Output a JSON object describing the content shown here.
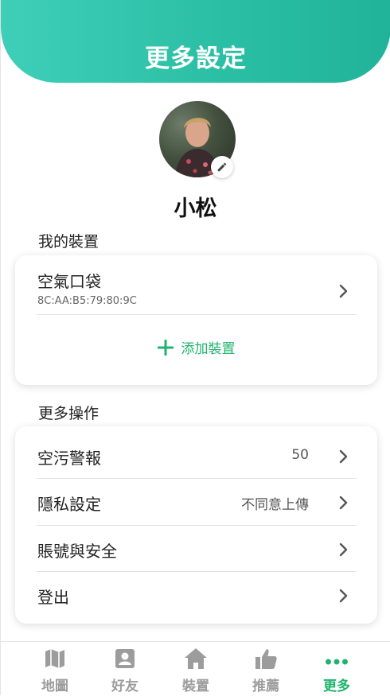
{
  "header": {
    "title": "更多設定"
  },
  "profile": {
    "name": "小松"
  },
  "devices": {
    "section_title": "我的裝置",
    "items": [
      {
        "name": "空氣口袋",
        "mac": "8C:AA:B5:79:80:9C"
      }
    ],
    "add_label": "添加裝置"
  },
  "operations": {
    "section_title": "更多操作",
    "items": [
      {
        "label": "空污警報",
        "value": "50"
      },
      {
        "label": "隱私設定",
        "value": "不同意上傳"
      },
      {
        "label": "賬號與安全",
        "value": ""
      },
      {
        "label": "登出",
        "value": ""
      }
    ]
  },
  "tabbar": {
    "active": "更多",
    "tabs": [
      {
        "label": "地圖",
        "icon": "map-icon"
      },
      {
        "label": "好友",
        "icon": "contact-icon"
      },
      {
        "label": "裝置",
        "icon": "home-icon"
      },
      {
        "label": "推薦",
        "icon": "thumbs-up-icon"
      },
      {
        "label": "更多",
        "icon": "more-dots-icon"
      }
    ]
  },
  "colors": {
    "accent": "#1fb36d",
    "header_gradient_start": "#3fcfb9",
    "header_gradient_end": "#20b39a",
    "tab_inactive": "#9c9c9c"
  }
}
